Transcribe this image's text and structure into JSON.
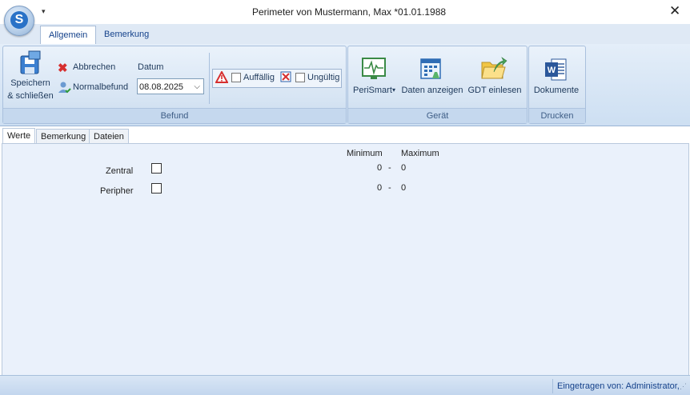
{
  "window": {
    "title": "Perimeter von Mustermann, Max *01.01.1988",
    "close_glyph": "✕",
    "orb_letter": "S"
  },
  "ribbon": {
    "tabs": [
      {
        "label": "Allgemein"
      },
      {
        "label": "Bemerkung"
      }
    ],
    "befund": {
      "save_label_1": "Speichern",
      "save_label_2": "& schließen",
      "cancel_label": "Abbrechen",
      "normal_label": "Normalbefund",
      "date_label": "Datum",
      "date_value": "08.08.2025",
      "auffaellig_label": "Auffällig",
      "ungueltig_label": "Ungültig",
      "group_label": "Befund"
    },
    "geraet": {
      "perismart_label": "PeriSmart",
      "daten_label": "Daten anzeigen",
      "gdt_label": "GDT einlesen",
      "group_label": "Gerät"
    },
    "drucken": {
      "dokumente_label": "Dokumente",
      "group_label": "Drucken"
    }
  },
  "subtabs": [
    {
      "label": "Werte"
    },
    {
      "label": "Bemerkung"
    },
    {
      "label": "Dateien"
    }
  ],
  "werte": {
    "min_header": "Minimum",
    "max_header": "Maximum",
    "rows": [
      {
        "label": "Zentral",
        "min": "0",
        "sep": "-",
        "max": "0"
      },
      {
        "label": "Peripher",
        "min": "0",
        "sep": "-",
        "max": "0"
      }
    ]
  },
  "status": {
    "text": "Eingetragen von: Administrator,"
  },
  "colors": {
    "ribbon_text": "#1e395b",
    "accent": "#2a72c7",
    "cancel_red": "#d62f2f"
  }
}
